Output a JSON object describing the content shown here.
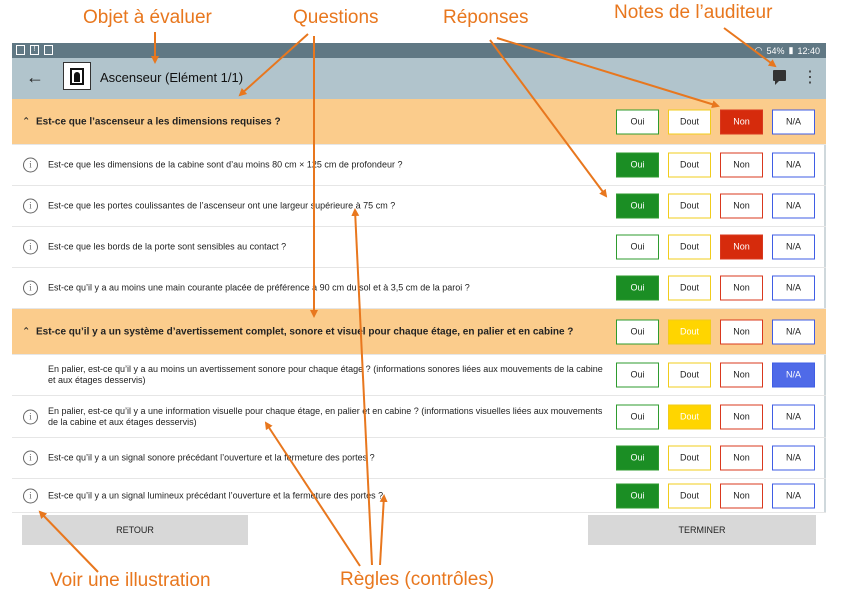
{
  "annotations": {
    "objet": "Objet à évaluer",
    "questions": "Questions",
    "reponses": "Réponses",
    "notes": "Notes de l’auditeur",
    "illustration": "Voir une illustration",
    "regles": "Règles (contrôles)"
  },
  "statusbar": {
    "battery": "54%",
    "time": "12:40"
  },
  "appbar": {
    "back_icon": "←",
    "title": "Ascenseur (Elément 1/1)",
    "menu_icon": "⋮"
  },
  "answer_labels": {
    "oui": "Oui",
    "dout": "Dout",
    "non": "Non",
    "na": "N/A"
  },
  "rows": [
    {
      "type": "group",
      "text": "Est-ce que l’ascenseur a les dimensions requises ?",
      "selected": "non"
    },
    {
      "type": "question",
      "info": true,
      "text": "Est-ce que les dimensions de la cabine sont d’au moins 80 cm × 125 cm de profondeur ?",
      "selected": "oui"
    },
    {
      "type": "question",
      "info": true,
      "text": "Est-ce que les portes coulissantes de l’ascenseur ont une largeur supérieure à 75 cm ?",
      "selected": "oui"
    },
    {
      "type": "question",
      "info": true,
      "text": "Est-ce que les bords de la porte sont sensibles au contact ?",
      "selected": "non"
    },
    {
      "type": "question",
      "info": true,
      "text": "Est-ce qu’il y a au moins une main courante placée de préférence à 90 cm du sol et à 3,5 cm de la paroi ?",
      "selected": "oui"
    },
    {
      "type": "group",
      "text": "Est-ce qu’il y a un système d’avertissement complet, sonore et visuel pour chaque étage, en palier et en cabine ?",
      "selected": "dout"
    },
    {
      "type": "question",
      "info": false,
      "text": "En palier, est-ce qu’il y a au moins un avertissement sonore pour chaque étage ? (informations sonores liées aux mouvements de la cabine et aux étages desservis)",
      "selected": "na"
    },
    {
      "type": "question",
      "info": true,
      "text": "En palier, est-ce qu’il y a une information visuelle pour chaque étage, en palier et en cabine ? (informations visuelles liées aux mouvements de la cabine et aux étages desservis)",
      "selected": "dout"
    },
    {
      "type": "question",
      "info": true,
      "text": "Est-ce qu’il y a un signal sonore précédant l’ouverture et la fermeture des portes ?",
      "selected": "oui"
    },
    {
      "type": "question",
      "info": true,
      "text": "Est-ce qu’il y a un signal lumineux précédant l’ouverture et la fermeture des portes ?",
      "selected": "oui"
    }
  ],
  "footer": {
    "retour": "RETOUR",
    "terminer": "TERMINER"
  },
  "colors": {
    "accent_annotation": "#e8771e",
    "group_bg": "#fbcc8c",
    "appbar_bg": "#b1c4cc",
    "oui": "#1b8e24",
    "dout": "#ffd500",
    "non": "#d62b0c",
    "na": "#4f6ae8"
  }
}
